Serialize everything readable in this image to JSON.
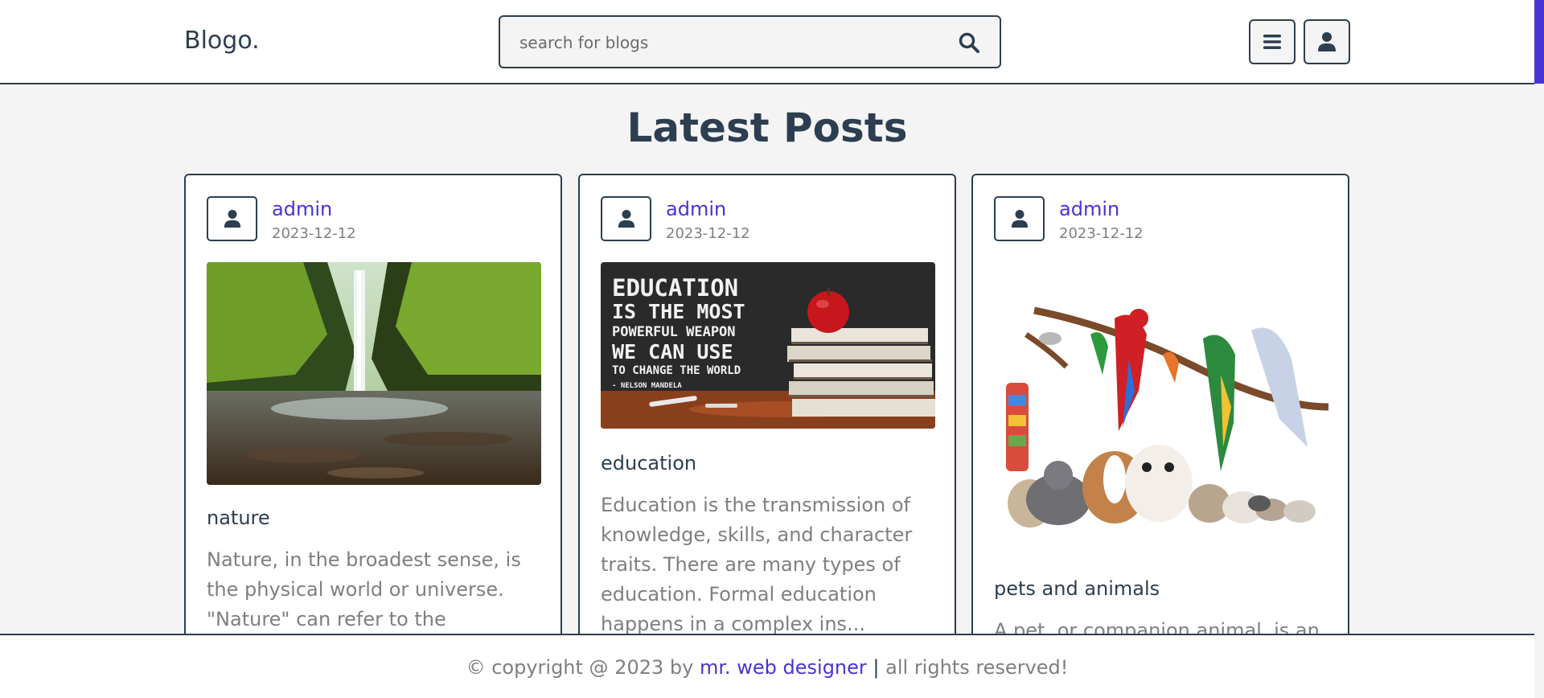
{
  "header": {
    "logo": "Blogo.",
    "search_placeholder": "search for blogs"
  },
  "main": {
    "title": "Latest Posts",
    "posts": [
      {
        "author": "admin",
        "date": "2023-12-12",
        "image": "waterfall-canyon-photo",
        "title": "nature",
        "excerpt": "Nature, in the broadest sense, is the physical world or universe. \"Nature\" can refer to the"
      },
      {
        "author": "admin",
        "date": "2023-12-12",
        "image": "chalkboard-books-apple-photo",
        "image_text": [
          "EDUCATION",
          "IS THE MOST",
          "POWERFUL WEAPON",
          "WE CAN USE",
          "TO CHANGE THE WORLD",
          "- NELSON MANDELA"
        ],
        "title": "education",
        "excerpt": "Education is the transmission of knowledge, skills, and character traits. There are many types of education. Formal education happens in a complex ins..."
      },
      {
        "author": "admin",
        "date": "2023-12-12",
        "image": "pets-parrots-dogs-cats-photo",
        "title": "pets and animals",
        "excerpt": "A pet, or companion animal, is an"
      }
    ]
  },
  "footer": {
    "prefix": "© copyright @ 2023 by ",
    "author_link": "mr. web designer",
    "separator": "|",
    "suffix": " all rights reserved!"
  },
  "colors": {
    "accent": "#4834d4",
    "primary": "#2c3e50",
    "muted": "#7f7f7f",
    "background": "#f4f4f4"
  }
}
